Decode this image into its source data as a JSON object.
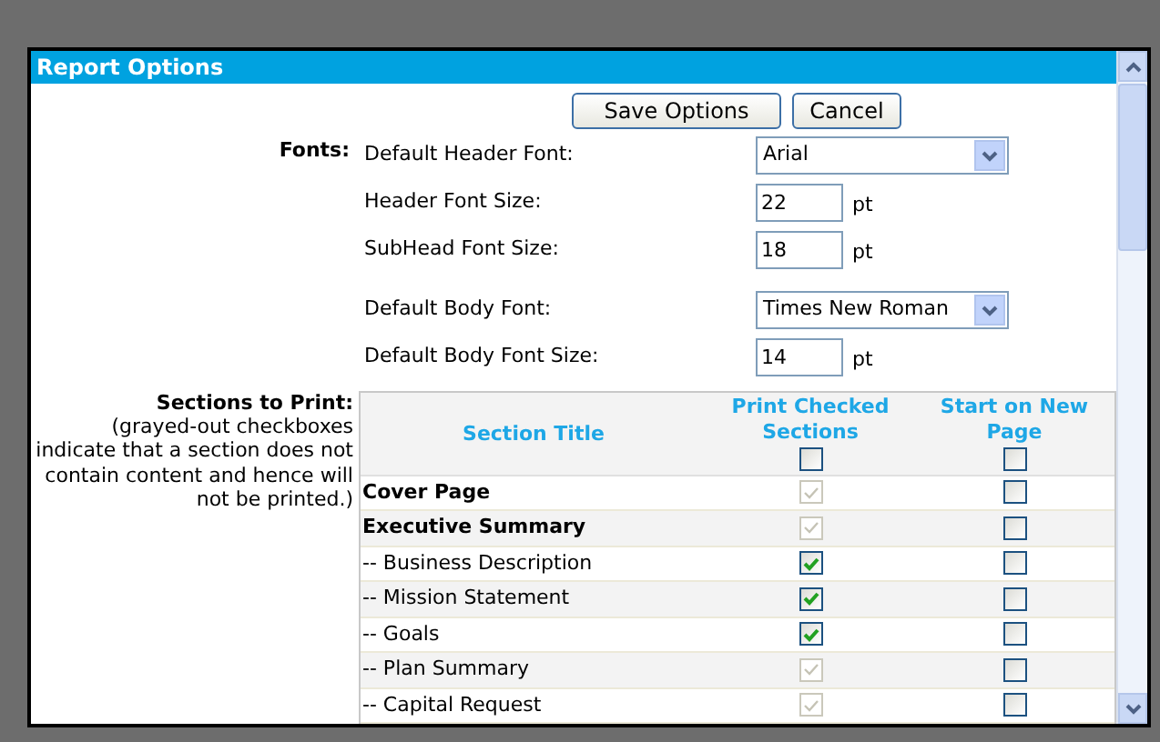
{
  "dialog": {
    "title": "Report Options"
  },
  "buttons": [
    "Save Options",
    "Cancel"
  ],
  "fonts": {
    "label": "Fonts:",
    "fields": [
      {
        "kind": "select",
        "label": "Default Header Font:",
        "value": "Arial",
        "gap_before": false
      },
      {
        "kind": "number",
        "label": "Header Font Size:",
        "value": "22",
        "unit": "pt",
        "gap_before": false
      },
      {
        "kind": "number",
        "label": "SubHead Font Size:",
        "value": "18",
        "unit": "pt",
        "gap_before": false
      },
      {
        "kind": "select",
        "label": "Default Body Font:",
        "value": "Times New Roman",
        "gap_before": true
      },
      {
        "kind": "number",
        "label": "Default Body Font Size:",
        "value": "14",
        "unit": "pt",
        "gap_before": false
      }
    ]
  },
  "sections": {
    "label": "Sections to Print:",
    "note": "(grayed-out checkboxes indicate that a section does not contain content and hence will not be printed.)",
    "columns": [
      {
        "label": "Section Title"
      },
      {
        "label": "Print Checked Sections",
        "checked": false
      },
      {
        "label": "Start on New Page",
        "checked": false
      }
    ],
    "rows": [
      {
        "title": "Cover Page",
        "bold": true,
        "print_checked": true,
        "print_disabled": true,
        "new_page": false
      },
      {
        "title": "Executive Summary",
        "bold": true,
        "print_checked": true,
        "print_disabled": true,
        "new_page": false
      },
      {
        "title": "-- Business Description",
        "bold": false,
        "print_checked": true,
        "print_disabled": false,
        "new_page": false
      },
      {
        "title": "-- Mission Statement",
        "bold": false,
        "print_checked": true,
        "print_disabled": false,
        "new_page": false
      },
      {
        "title": "-- Goals",
        "bold": false,
        "print_checked": true,
        "print_disabled": false,
        "new_page": false
      },
      {
        "title": "-- Plan Summary",
        "bold": false,
        "print_checked": true,
        "print_disabled": true,
        "new_page": false
      },
      {
        "title": "-- Capital Request",
        "bold": false,
        "print_checked": true,
        "print_disabled": true,
        "new_page": false
      }
    ]
  }
}
